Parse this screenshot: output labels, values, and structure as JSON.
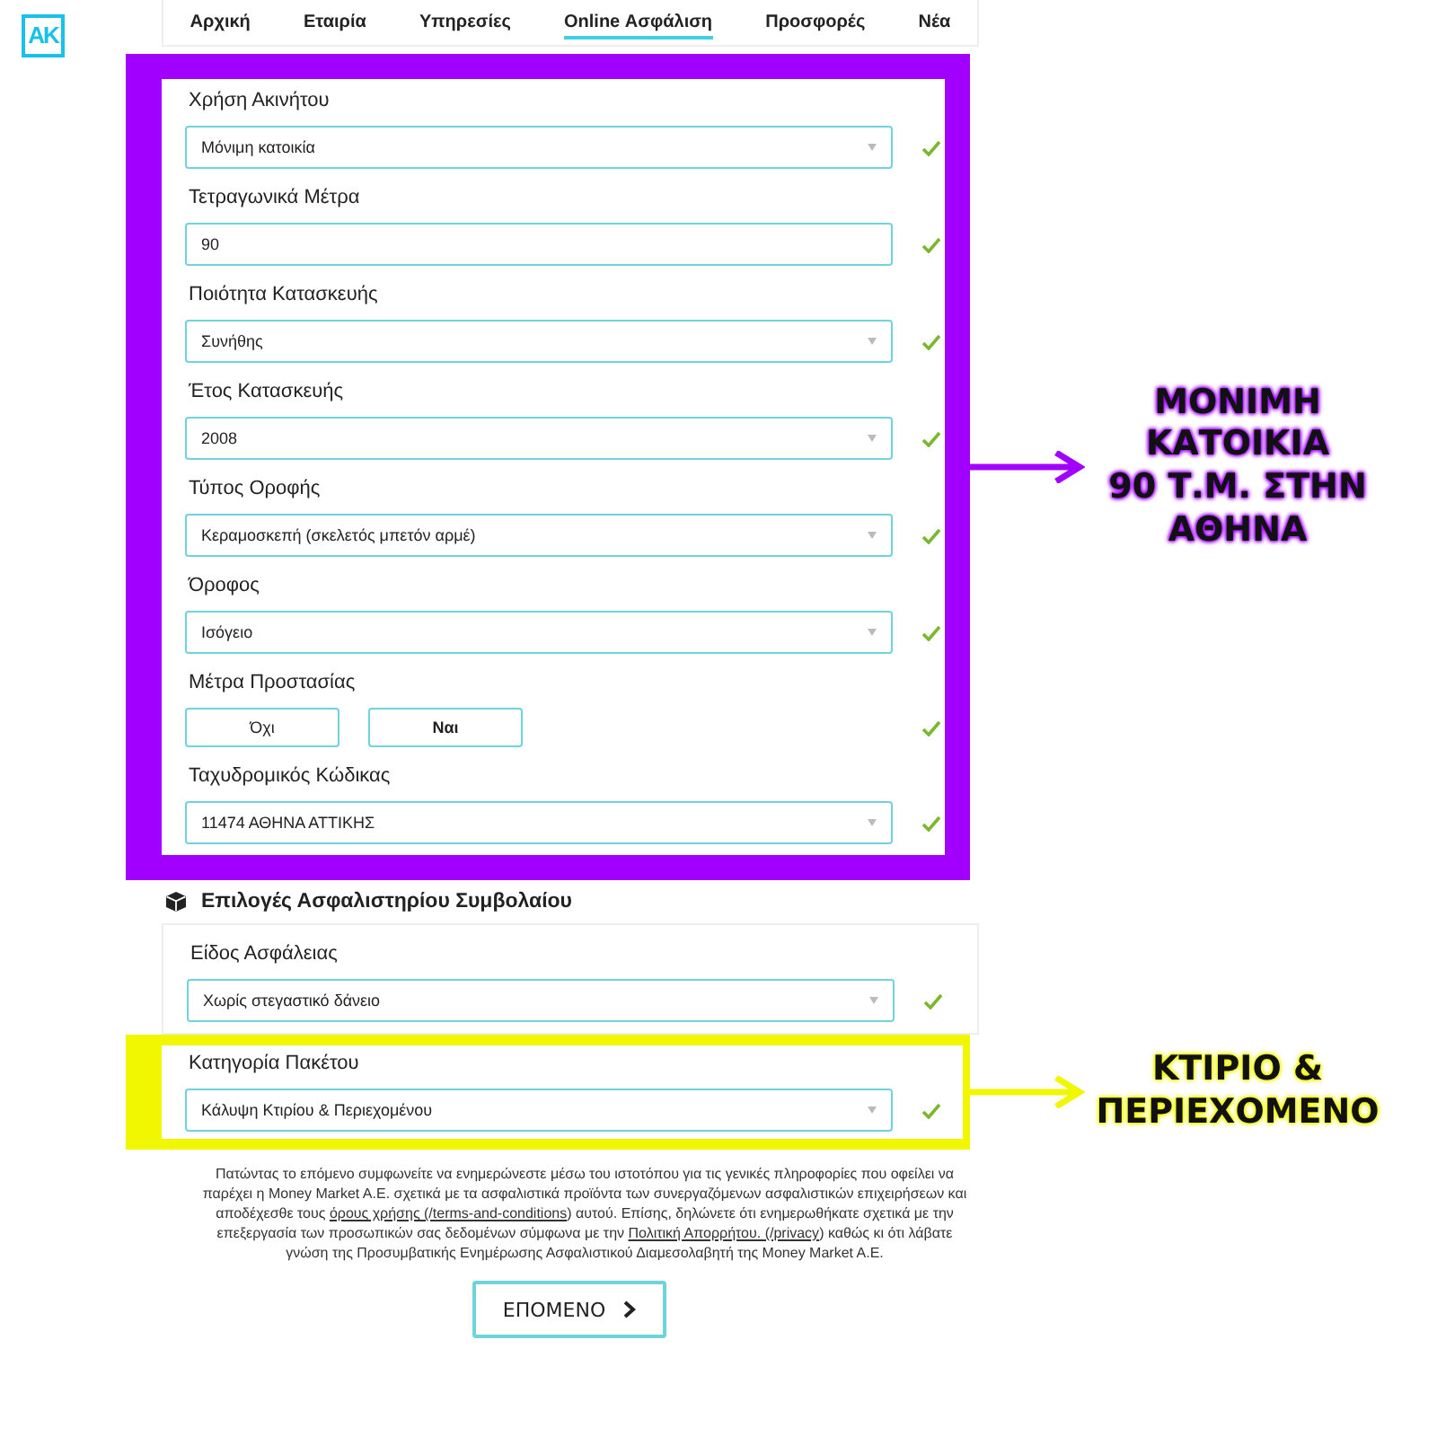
{
  "logo": {
    "text": "AK"
  },
  "nav": [
    {
      "label": "Αρχική",
      "selected": false
    },
    {
      "label": "Εταιρία",
      "selected": false
    },
    {
      "label": "Υπηρεσίες",
      "selected": false
    },
    {
      "label": "Online Ασφάλιση",
      "selected": true
    },
    {
      "label": "Προσφορές",
      "selected": false
    },
    {
      "label": "Νέα",
      "selected": false
    }
  ],
  "property_fields": [
    {
      "label": "Χρήση Ακινήτου",
      "kind": "select",
      "value": "Μόνιμη κατοικία",
      "valid": true
    },
    {
      "label": "Τετραγωνικά Μέτρα",
      "kind": "text",
      "value": "90",
      "valid": true
    },
    {
      "label": "Ποιότητα Κατασκευής",
      "kind": "select",
      "value": "Συνήθης",
      "valid": true
    },
    {
      "label": "Έτος Κατασκευής",
      "kind": "select",
      "value": "2008",
      "valid": true
    },
    {
      "label": "Τύπος Οροφής",
      "kind": "select",
      "value": "Κεραμοσκεπή (σκελετός μπετόν αρμέ)",
      "valid": true
    },
    {
      "label": "Όροφος",
      "kind": "select",
      "value": "Ισόγειο",
      "valid": true
    },
    {
      "label": "Μέτρα Προστασίας",
      "kind": "choice",
      "options": [
        {
          "label": "Όχι",
          "selected": false
        },
        {
          "label": "Ναι",
          "selected": true
        }
      ],
      "valid": true
    },
    {
      "label": "Ταχυδρομικός Κώδικας",
      "kind": "select",
      "value": "11474 ΑΘΗΝΑ ΑΤΤΙΚΗΣ",
      "valid": true
    }
  ],
  "policy_options": {
    "title": "Επιλογές Ασφαλιστηρίου Συμβολαίου",
    "fields": [
      {
        "label": "Είδος Ασφάλειας",
        "kind": "select",
        "value": "Χωρίς στεγαστικό δάνειο",
        "valid": true
      },
      {
        "label": "Κατηγορία Πακέτου",
        "kind": "select",
        "value": "Κάλυψη Κτιρίου & Περιεχομένου",
        "valid": true
      }
    ]
  },
  "annotations": [
    {
      "text": "ΜΟΝΙΜΗ\nΚΑΤΟΙΚΙΑ\n90 Τ.Μ. ΣΤΗΝ\nΑΘΗΝΑ",
      "color": "#a100ff"
    },
    {
      "text": "ΚΤΙΡΙΟ &\nΠΕΡΙΕΧΟΜΕΝΟ",
      "color": "#f0f700"
    }
  ],
  "legal_text": [
    {
      "kind": "text",
      "text": "Πατώντας το επόμενο συμφωνείτε να ενημερώνεστε μέσω του ιστοτόπου για τις γενικές πληροφορίες που οφείλει να παρέχει η Money Market A.E. σχετικά με τα ασφαλιστικά προϊόντα των συνεργαζόμενων ασφαλιστικών επιχειρήσεων και αποδέχεσθε τους "
    },
    {
      "kind": "link",
      "text": "όρους χρήσης (/terms-and-conditions"
    },
    {
      "kind": "text",
      "text": ") αυτού. Επίσης, δηλώνετε ότι ενημερωθήκατε σχετικά με την επεξεργασία των προσωπικών σας δεδομένων σύμφωνα με την "
    },
    {
      "kind": "link",
      "text": "Πολιτική Απορρήτου. (/privacy"
    },
    {
      "kind": "text",
      "text": ") καθώς κι ότι λάβατε γνώση της Προσυμβατικής Ενημέρωσης Ασφαλιστικού Διαμεσολαβητή της Money Market A.E."
    }
  ],
  "next_button": {
    "label": "ΕΠΟΜΕΝΟ"
  }
}
